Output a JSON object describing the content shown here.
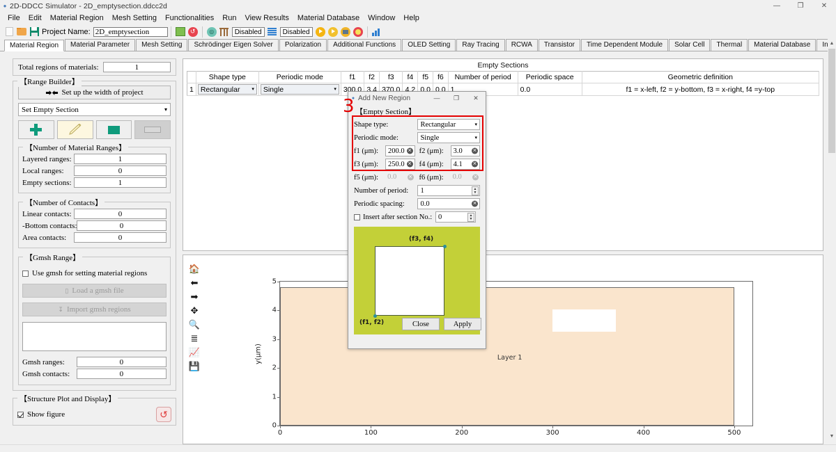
{
  "window": {
    "title": "2D-DDCC Simulator - 2D_emptysection.ddcc2d",
    "minimize": "—",
    "maximize": "❐",
    "close": "✕"
  },
  "menu": {
    "items": [
      "File",
      "Edit",
      "Material Region",
      "Mesh Setting",
      "Functionalities",
      "Run",
      "View Results",
      "Material Database",
      "Window",
      "Help"
    ]
  },
  "toolbar": {
    "project_label": "Project Name:",
    "project_value": "2D_emptysection",
    "status_one": "Disabled",
    "status_two": "Disabled",
    "icons": [
      "new-document-icon",
      "open-folder-icon",
      "save-icon",
      "structure-plot-icon",
      "refresh-icon",
      "mesh-generate-icon",
      "mesh-column-icon",
      "list-icon",
      "run-icon",
      "run-step-icon",
      "export-icon",
      "stop-icon",
      "chart-icon"
    ]
  },
  "tabs": [
    {
      "label": "Material Region",
      "active": true
    },
    {
      "label": "Material Parameter",
      "active": false
    },
    {
      "label": "Mesh Setting",
      "active": false
    },
    {
      "label": "Schrödinger Eigen Solver",
      "active": false
    },
    {
      "label": "Polarization",
      "active": false
    },
    {
      "label": "Additional Functions",
      "active": false
    },
    {
      "label": "OLED Setting",
      "active": false
    },
    {
      "label": "Ray Tracing",
      "active": false
    },
    {
      "label": "RCWA",
      "active": false
    },
    {
      "label": "Transistor",
      "active": false
    },
    {
      "label": "Time Dependent Module",
      "active": false
    },
    {
      "label": "Solar Cell",
      "active": false
    },
    {
      "label": "Thermal",
      "active": false
    },
    {
      "label": "Material Database",
      "active": false
    },
    {
      "label": "Input Editor",
      "active": false
    }
  ],
  "sidebar": {
    "total_regions_label": "Total regions of materials:",
    "total_regions_value": "1",
    "range_builder_title": "【Range Builder】",
    "setup_width_button": "Set up the width of project",
    "section_mode": "Set Empty Section",
    "action_buttons": [
      "add-region-button",
      "edit-region-button",
      "delete-region-button",
      "duplicate-region-button"
    ],
    "material_ranges_title": "【Number of Material Ranges】",
    "material_ranges": [
      {
        "label": "Layered ranges:",
        "value": "1"
      },
      {
        "label": "Local ranges:",
        "value": "0"
      },
      {
        "label": "Empty sections:",
        "value": "1"
      }
    ],
    "contacts_title": "【Number of Contacts】",
    "contacts": [
      {
        "label": "Linear contacts:",
        "value": "0"
      },
      {
        "label": "-Bottom contacts:",
        "value": "0"
      },
      {
        "label": "Area contacts:",
        "value": "0"
      }
    ],
    "gmsh_title": "【Gmsh Range】",
    "gmsh_checkbox": "Use gmsh for setting material regions",
    "gmsh_checked": false,
    "load_gmsh_button": "Load a gmsh file",
    "import_gmsh_button": "Import gmsh regions",
    "gmsh_list_value": "",
    "gmsh_fields": [
      {
        "label": "Gmsh ranges:",
        "value": "0"
      },
      {
        "label": "Gmsh contacts:",
        "value": "0"
      }
    ],
    "structure_plot_title": "【Structure Plot and Display】",
    "show_figure_label": "Show figure",
    "show_figure_checked": true
  },
  "sections_panel": {
    "title": "Empty Sections",
    "columns": [
      "",
      "Shape type",
      "Periodic mode",
      "f1",
      "f2",
      "f3",
      "f4",
      "f5",
      "f6",
      "Number of period",
      "Periodic space",
      "Geometric definition"
    ],
    "rows": [
      {
        "index": "1",
        "shape_type": "Rectangular",
        "periodic_mode": "Single",
        "f1": "300.0",
        "f2": "3.4",
        "f3": "370.0",
        "f4": "4.2",
        "f5": "0.0",
        "f6": "0.0",
        "number_of_period": "1",
        "periodic_space": "0.0",
        "geometric_definition": "f1 = x-left, f2 = y-bottom, f3 = x-right, f4 =y-top"
      }
    ]
  },
  "dialog": {
    "title": "Add New Region",
    "minimize": "—",
    "maximize": "❐",
    "close": "✕",
    "step_marker": "3",
    "group_title": "【Empty Section】",
    "shape_type_label": "Shape type:",
    "shape_type_value": "Rectangular",
    "periodic_mode_label": "Periodic mode:",
    "periodic_mode_value": "Single",
    "f_fields": [
      {
        "label": "f1 (μm):",
        "value": "200.0",
        "enabled": true
      },
      {
        "label": "f2 (μm):",
        "value": "3.0",
        "enabled": true
      },
      {
        "label": "f3 (μm):",
        "value": "250.0",
        "enabled": true
      },
      {
        "label": "f4 (μm):",
        "value": "4.1",
        "enabled": true
      },
      {
        "label": "f5 (μm):",
        "value": "0.0",
        "enabled": false
      },
      {
        "label": "f6 (μm):",
        "value": "0.0",
        "enabled": false
      }
    ],
    "number_of_period_label": "Number of period:",
    "number_of_period_value": "1",
    "periodic_spacing_label": "Periodic spacing:",
    "periodic_spacing_value": "0.0",
    "insert_after_label": "Insert after section No.:",
    "insert_after_value": "0",
    "insert_after_checked": false,
    "preview": {
      "top_right_label": "(f3, f4)",
      "bottom_left_label": "(f1, f2)",
      "background_color": "#c3d038",
      "inner_color": "#ffffff"
    },
    "close_button": "Close",
    "apply_button": "Apply",
    "highlight_color": "#e40000"
  },
  "plot": {
    "toolbar_icons": [
      "home-icon",
      "back-arrow-icon",
      "forward-arrow-icon",
      "pan-move-icon",
      "zoom-magnifier-icon",
      "configure-subplots-icon",
      "edit-axis-curve-icon",
      "save-figure-icon"
    ],
    "layer_label": "Layer 1"
  },
  "chart_data": {
    "type": "area",
    "title": "",
    "xlabel": "",
    "ylabel": "y(μm)",
    "xlim": [
      0,
      520
    ],
    "ylim": [
      0,
      5.2
    ],
    "xticks": [
      0,
      100,
      200,
      300,
      400,
      500
    ],
    "yticks": [
      0,
      1,
      2,
      3,
      4,
      5
    ],
    "grid": false,
    "legend": "none",
    "regions": [
      {
        "name": "Layer 1",
        "color": "#fae5cd",
        "x0": 0,
        "y0": 0,
        "x1": 500,
        "y1": 5,
        "label": "Layer 1",
        "label_x": 240,
        "label_y": 2.45
      },
      {
        "name": "Empty section 1",
        "color": "#ffffff",
        "x0": 300,
        "y0": 3.4,
        "x1": 370,
        "y1": 4.2,
        "label": "",
        "label_x": 0,
        "label_y": 0
      }
    ]
  }
}
